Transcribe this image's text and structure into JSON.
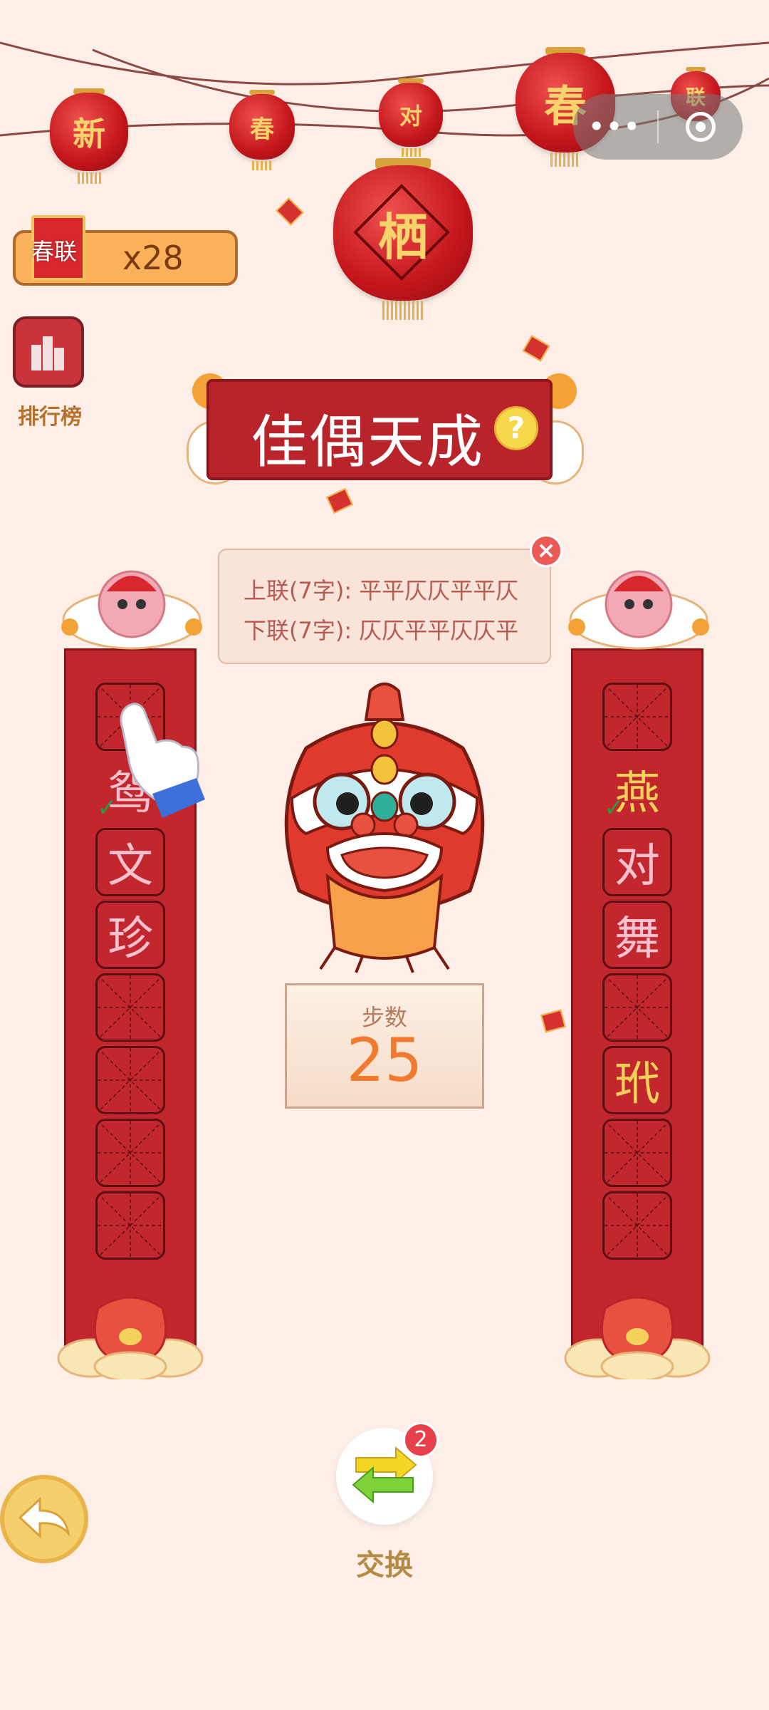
{
  "lanterns": [
    {
      "char": "新"
    },
    {
      "char": "春"
    },
    {
      "char": "对"
    },
    {
      "char": "春"
    },
    {
      "char": "联"
    },
    {
      "char": "栖"
    }
  ],
  "capsule": {
    "more_label": "•••"
  },
  "counter": {
    "icon_text": "春联",
    "value": "x28"
  },
  "ranking": {
    "label": "排行榜"
  },
  "title": {
    "text": "佳偶天成",
    "help_label": "?"
  },
  "hint": {
    "upper": "上联(7字): 平平仄仄平平仄",
    "lower": "下联(7字): 仄仄平平仄仄平",
    "close_label": "×"
  },
  "left_couplet": {
    "cells": [
      {
        "char": "",
        "color": "#f7c1cf"
      },
      {
        "char": "鸳",
        "color": "#f7c1cf",
        "checked": true
      },
      {
        "char": "文",
        "color": "#f7c1cf"
      },
      {
        "char": "珍",
        "color": "#f7c1cf"
      },
      {
        "char": "",
        "color": "#f7c1cf"
      },
      {
        "char": "",
        "color": "#f7c1cf"
      },
      {
        "char": "",
        "color": "#f7c1cf"
      },
      {
        "char": "",
        "color": "#f7c1cf"
      }
    ]
  },
  "right_couplet": {
    "cells": [
      {
        "char": "",
        "color": "#f4d15a"
      },
      {
        "char": "燕",
        "color": "#f4d15a",
        "checked": true
      },
      {
        "char": "对",
        "color": "#f7c1cf"
      },
      {
        "char": "舞",
        "color": "#f7c1cf"
      },
      {
        "char": "",
        "color": "#f7c1cf"
      },
      {
        "char": "玳",
        "color": "#f4d15a"
      },
      {
        "char": "",
        "color": "#f7c1cf"
      },
      {
        "char": "",
        "color": "#f7c1cf"
      }
    ]
  },
  "steps": {
    "label": "步数",
    "value": "25"
  },
  "swap": {
    "label": "交换",
    "badge": "2"
  },
  "colors": {
    "background": "#fdefe7",
    "couplet_red": "#c1272d",
    "accent_orange": "#f27a2f"
  }
}
